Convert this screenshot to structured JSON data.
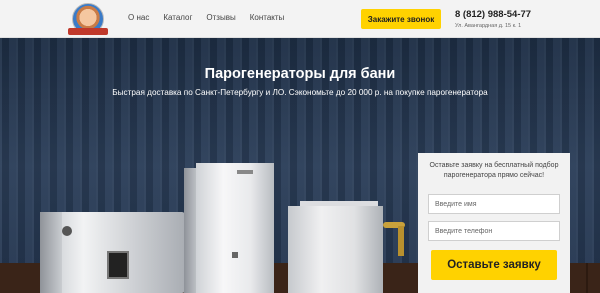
{
  "nav": {
    "items": [
      {
        "label": "О нас"
      },
      {
        "label": "Каталог"
      },
      {
        "label": "Отзывы"
      },
      {
        "label": "Контакты"
      }
    ]
  },
  "header": {
    "callback_button": "Закажите звонок",
    "phone": "8 (812) 988-54-77",
    "address": "Ул. Авангардная д. 15 к. 1"
  },
  "hero": {
    "title": "Парогенераторы для бани",
    "subtitle": "Быстрая доставка по Санкт-Петербургу и ЛО. Сэкономьте до 20 000 р. на покупке парогенератора"
  },
  "form": {
    "intro": "Оставьте заявку на бесплатный подбор парогенератора прямо сейчас!",
    "name_placeholder": "Введите имя",
    "phone_placeholder": "Введите телефон",
    "submit_label": "Оставьте заявку"
  },
  "colors": {
    "accent": "#ffd200",
    "hero_bg": "#2c3f5a"
  },
  "icons": {
    "logo": "mascot-logo-icon"
  }
}
